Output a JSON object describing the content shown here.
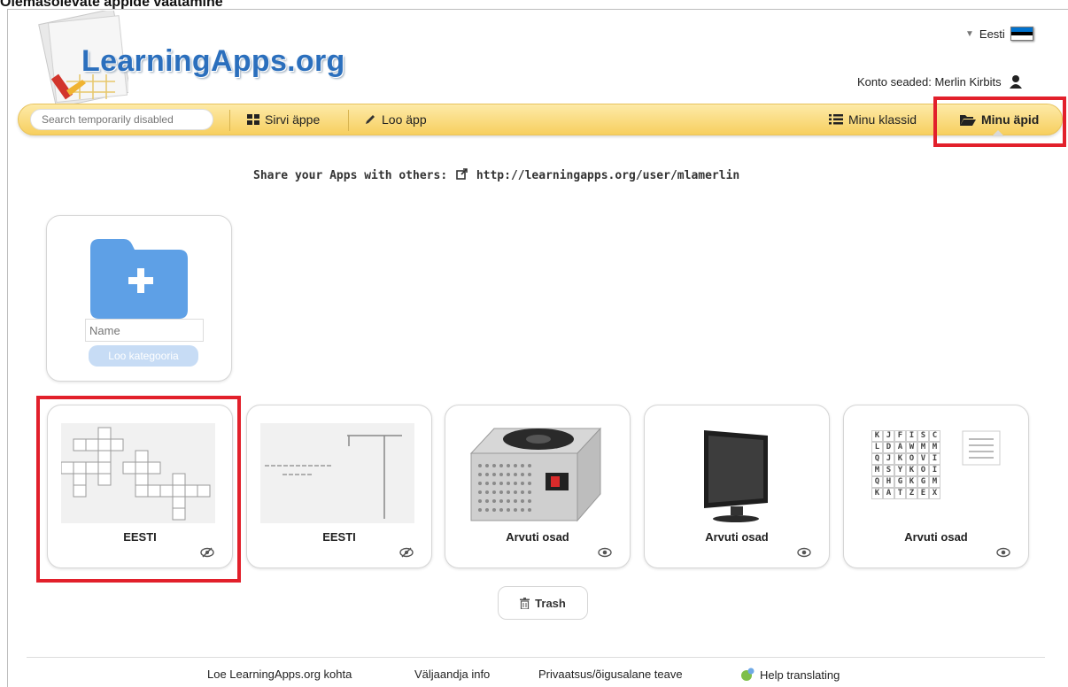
{
  "caption": "Olemasolevate äppide vaatamine",
  "header": {
    "logo_text": "LearningApps.org",
    "language": "Eesti",
    "account_label": "Konto seaded: Merlin Kirbits"
  },
  "nav": {
    "search_placeholder": "Search temporarily disabled",
    "browse": "Sirvi äppe",
    "create": "Loo äpp",
    "classes": "Minu klassid",
    "myapps": "Minu äpid"
  },
  "share": {
    "label": "Share your Apps with others:",
    "url": "http://learningapps.org/user/mlamerlin"
  },
  "category": {
    "name_placeholder": "Name",
    "button": "Loo kategooria"
  },
  "apps": [
    {
      "title": "EESTI",
      "thumb": "crossword",
      "visibility": "hidden"
    },
    {
      "title": "EESTI",
      "thumb": "hangman",
      "visibility": "hidden"
    },
    {
      "title": "Arvuti osad",
      "thumb": "power-supply",
      "visibility": "visible"
    },
    {
      "title": "Arvuti osad",
      "thumb": "monitor",
      "visibility": "visible"
    },
    {
      "title": "Arvuti osad",
      "thumb": "word-grid",
      "visibility": "visible"
    }
  ],
  "wordgrid": [
    [
      "K",
      "J",
      "F",
      "I",
      "S",
      "C"
    ],
    [
      "L",
      "D",
      "A",
      "W",
      "M",
      "M"
    ],
    [
      "Q",
      "J",
      "K",
      "O",
      "V",
      "I"
    ],
    [
      "M",
      "S",
      "Y",
      "K",
      "O",
      "I"
    ],
    [
      "Q",
      "H",
      "G",
      "K",
      "G",
      "M"
    ],
    [
      "K",
      "A",
      "T",
      "Z",
      "E",
      "X"
    ]
  ],
  "trash": "Trash",
  "footer": {
    "about": "Loe LearningApps.org kohta",
    "publisher": "Väljaandja info",
    "privacy": "Privaatsus/õigusalane teave",
    "translate": "Help translating"
  },
  "colors": {
    "brand_blue": "#2b6fbd",
    "nav_yellow": "#f7cf5f",
    "highlight_red": "#e2202b",
    "folder_blue": "#5ea0e6",
    "flag_blue": "#0072ce"
  },
  "icons": {
    "browse": "grid-icon",
    "create": "pencil-icon",
    "classes": "list-icon",
    "myapps": "folder-open-icon",
    "share": "external-link-icon",
    "trash": "trash-icon",
    "visibility_hidden": "eye-slash-icon",
    "visibility_visible": "eye-icon",
    "account": "user-icon",
    "translate": "globe-icon"
  }
}
